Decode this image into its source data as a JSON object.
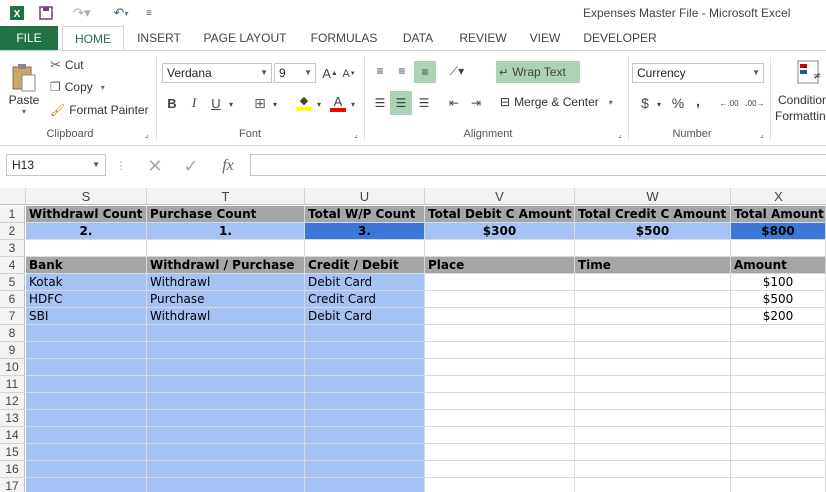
{
  "window": {
    "title": "Expenses Master File - Microsoft Excel",
    "app_icon": "excel-icon",
    "quick_access": [
      "save-icon",
      "redo-icon",
      "undo-icon",
      "customize-icon"
    ]
  },
  "ribbon": {
    "tabs": [
      "FILE",
      "HOME",
      "INSERT",
      "PAGE LAYOUT",
      "FORMULAS",
      "DATA",
      "REVIEW",
      "VIEW",
      "DEVELOPER"
    ],
    "active_tab": "HOME",
    "clipboard": {
      "paste": "Paste",
      "cut": "Cut",
      "copy": "Copy",
      "format_painter": "Format Painter",
      "label": "Clipboard"
    },
    "font": {
      "name": "Verdana",
      "size": "9",
      "label": "Font",
      "bold": "B",
      "italic": "I",
      "underline": "U"
    },
    "alignment": {
      "wrap_text": "Wrap Text",
      "merge_center": "Merge & Center",
      "label": "Alignment"
    },
    "number": {
      "format": "Currency",
      "currency_symbol": "$",
      "percent": "%",
      "comma": ",",
      "inc_decimal": ".00",
      "dec_decimal": ".00",
      "label": "Number"
    },
    "styles": {
      "conditional_line1": "Condition",
      "conditional_line2": "Formattin"
    }
  },
  "formula_bar": {
    "name_box": "H13",
    "formula": ""
  },
  "sheet": {
    "columns": [
      "S",
      "T",
      "U",
      "V",
      "W",
      "X"
    ],
    "rows": [
      "1",
      "2",
      "3",
      "4",
      "5",
      "6",
      "7",
      "8",
      "9",
      "10",
      "11",
      "12",
      "13",
      "14",
      "15",
      "16",
      "17"
    ],
    "row1": [
      "Withdrawl Count",
      "Purchase Count",
      "Total W/P Count",
      "Total Debit C Amount",
      "Total Credit C Amount",
      "Total Amount"
    ],
    "row2": [
      "2.",
      "1.",
      "3.",
      "$300",
      "$500",
      "$800"
    ],
    "row4": [
      "Bank",
      "Withdrawl / Purchase",
      "Credit / Debit",
      "Place",
      "Time",
      "Amount"
    ],
    "data": [
      [
        "Kotak",
        "Withdrawl",
        "Debit Card",
        "",
        "",
        "$100"
      ],
      [
        "HDFC",
        "Purchase",
        "Credit Card",
        "",
        "",
        "$500"
      ],
      [
        "SBI",
        "Withdrawl",
        "Debit Card",
        "",
        "",
        "$200"
      ]
    ],
    "colors": {
      "header_gray": "#a6a6a6",
      "light_blue": "#a4c2f4",
      "dark_blue": "#3c78d8",
      "accent_green": "#217346"
    }
  }
}
